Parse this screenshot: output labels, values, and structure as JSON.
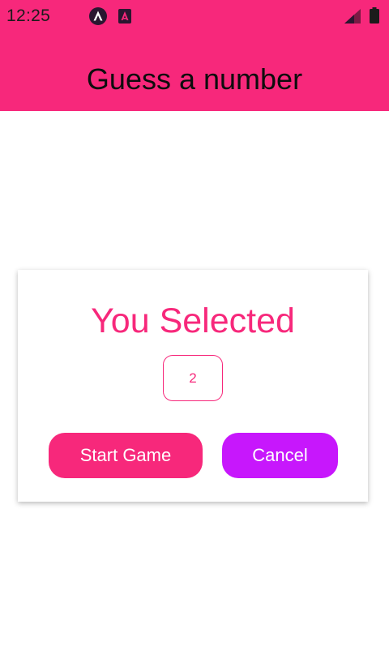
{
  "status_bar": {
    "time": "12:25",
    "notification_icons": [
      "expo-notification-icon",
      "app-notification-icon"
    ],
    "system_icons": [
      "signal-icon",
      "battery-icon"
    ]
  },
  "header": {
    "title": "Guess a number",
    "background_color": "#f7287b"
  },
  "card": {
    "title": "You Selected",
    "selected_number": "2",
    "start_button_label": "Start Game",
    "cancel_button_label": "Cancel"
  },
  "colors": {
    "primary": "#f7287b",
    "accent": "#c717fc"
  }
}
